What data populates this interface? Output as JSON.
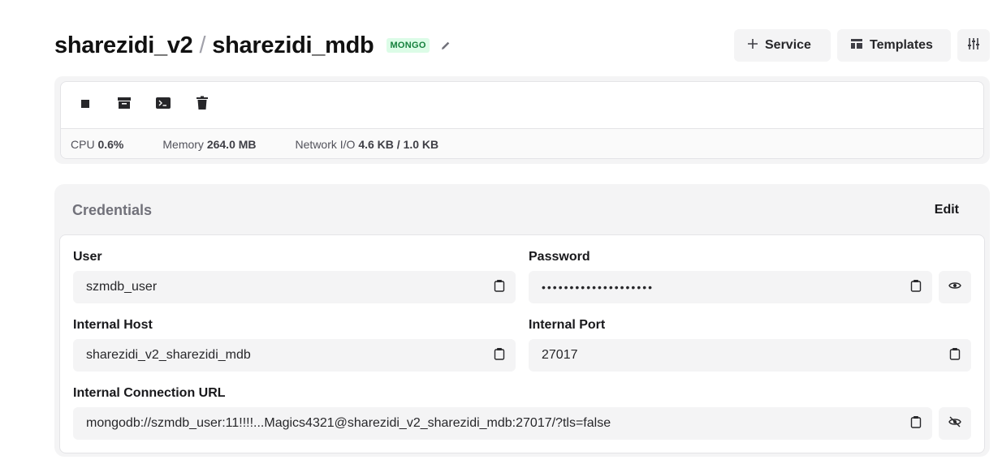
{
  "header": {
    "project": "sharezidi_v2",
    "separator": "/",
    "service": "sharezidi_mdb",
    "badge": "MONGO",
    "service_button": "Service",
    "templates_button": "Templates"
  },
  "status": {
    "cpu_label": "CPU",
    "cpu_value": "0.6%",
    "memory_label": "Memory",
    "memory_value": "264.0 MB",
    "network_label": "Network I/O",
    "network_value": "4.6 KB / 1.0 KB"
  },
  "credentials": {
    "title": "Credentials",
    "edit_label": "Edit",
    "user_label": "User",
    "user_value": "szmdb_user",
    "password_label": "Password",
    "password_value": "••••••••••••••••••••",
    "host_label": "Internal Host",
    "host_value": "sharezidi_v2_sharezidi_mdb",
    "port_label": "Internal Port",
    "port_value": "27017",
    "url_label": "Internal Connection URL",
    "url_value": "mongodb://szmdb_user:11!!!!...Magics4321@sharezidi_v2_sharezidi_mdb:27017/?tls=false"
  },
  "icons": {
    "edit": "pencil-icon",
    "add": "plus-icon",
    "templates": "layout-icon",
    "settings": "sliders-icon",
    "stop": "stop-icon",
    "archive": "archive-icon",
    "terminal": "terminal-icon",
    "delete": "trash-icon",
    "copy": "clipboard-icon",
    "show": "eye-icon",
    "hide": "eye-off-icon"
  },
  "colors": {
    "badge_bg": "#dcfce7",
    "badge_text": "#15803d",
    "panel_bg": "#f4f4f5"
  }
}
